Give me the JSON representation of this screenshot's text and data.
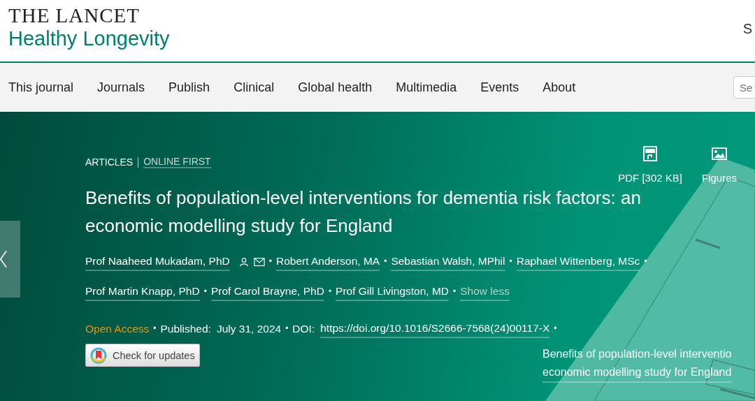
{
  "header": {
    "logo_top": "THE LANCET",
    "logo_bottom": "Healthy Longevity",
    "account_link": "S"
  },
  "nav": {
    "items": [
      {
        "label": "This journal"
      },
      {
        "label": "Journals"
      },
      {
        "label": "Publish"
      },
      {
        "label": "Clinical"
      },
      {
        "label": "Global health"
      },
      {
        "label": "Multimedia"
      },
      {
        "label": "Events"
      },
      {
        "label": "About"
      }
    ],
    "search": {
      "placeholder": "Se"
    }
  },
  "article": {
    "category": "ARTICLES",
    "section_link": "ONLINE FIRST",
    "tools": [
      {
        "kind": "pdf",
        "label": "PDF [302 KB]"
      },
      {
        "kind": "figures",
        "label": "Figures"
      }
    ],
    "title": "Benefits of population-level interventions for dementia risk factors: an economic modelling study for England",
    "authors": [
      {
        "name": "Prof Naaheed Mukadam, PhD",
        "corresponding": true,
        "separator": "•"
      },
      {
        "name": "Robert Anderson, MA",
        "corresponding": false,
        "separator": "•"
      },
      {
        "name": "Sebastian Walsh, MPhil",
        "corresponding": false,
        "separator": "•"
      },
      {
        "name": "Raphael Wittenberg, MSc",
        "corresponding": false,
        "separator": "•"
      },
      {
        "name": "Prof Martin Knapp, PhD",
        "corresponding": false,
        "separator": "•"
      },
      {
        "name": "Prof Carol Brayne, PhD",
        "corresponding": false,
        "separator": "•"
      },
      {
        "name": "Prof Gill Livingston, MD",
        "corresponding": false,
        "separator": "•"
      }
    ],
    "toggle": "Show less",
    "meta": [
      {
        "kind": "access",
        "text": "Open Access"
      },
      {
        "kind": "separator",
        "text": "•"
      },
      {
        "kind": "label",
        "text": "Published:"
      },
      {
        "kind": "value",
        "text": "July 31, 2024"
      },
      {
        "kind": "separator",
        "text": "•"
      },
      {
        "kind": "label",
        "text": "DOI:"
      },
      {
        "kind": "link",
        "text": "https://doi.org/10.1016/S2666-7568(24)00117-X"
      },
      {
        "kind": "separator",
        "text": "•"
      }
    ],
    "update_button": "Check for updates",
    "figure_caption": [
      "Benefits of population-level interventio",
      "economic modelling study for England"
    ]
  }
}
